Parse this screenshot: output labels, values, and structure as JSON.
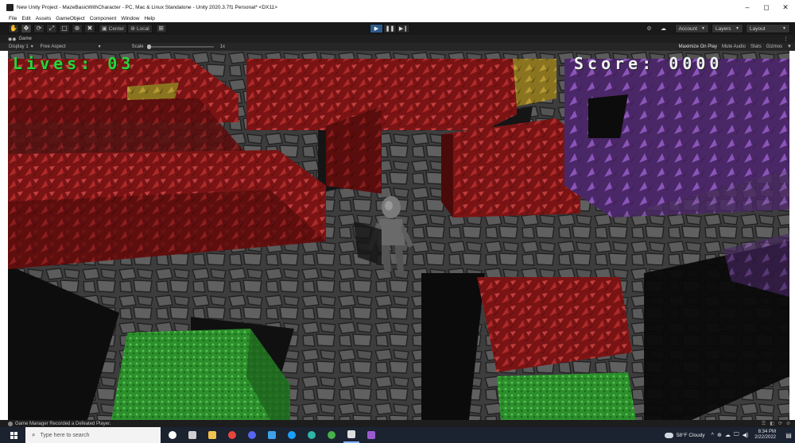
{
  "window": {
    "title": "New Unity Project - MazeBasicWithCharacter - PC, Mac & Linux Standalone - Unity 2020.3.7f1 Personal* <DX11>",
    "controls": [
      "–",
      "◻",
      "✕"
    ]
  },
  "menu": [
    "File",
    "Edit",
    "Assets",
    "GameObject",
    "Component",
    "Window",
    "Help"
  ],
  "toolbar": {
    "tools": [
      "✋",
      "✥",
      "⟳",
      "⤢",
      "▢",
      "⊕",
      "✖"
    ],
    "pivot_label": "Center",
    "space_label": "Local",
    "snap_glyph": "⊞",
    "play": [
      "▶",
      "❚❚",
      "▶❙"
    ],
    "collab_glyph": "⚙",
    "cloud_glyph": "☁",
    "account_label": "Account",
    "layers_label": "Layers",
    "layout_label": "Layout"
  },
  "game_tab": {
    "label": "Game",
    "display": "Display 1",
    "aspect": "Free Aspect",
    "scale_label": "Scale",
    "scale_value": "1x",
    "maximize_on_play": "Maximize On Play",
    "mute_audio": "Mute Audio",
    "stats": "Stats",
    "gizmos": "Gizmos"
  },
  "hud": {
    "lives": "Lives: 03",
    "score": "Score: 0000"
  },
  "status": {
    "message": "Game Manager Recorded a Defeated Player.",
    "right_icons": [
      "☰",
      "◧",
      "⟳",
      "⊘"
    ]
  },
  "taskbar": {
    "search_placeholder": "Type here to search",
    "weather": "58°F Cloudy",
    "tray_glyphs": [
      "^",
      "⊕",
      "☁",
      "🖵",
      "◀)"
    ],
    "time": "8:34 PM",
    "date": "2/22/2022",
    "apps": [
      {
        "name": "cortana",
        "color": "#ffffff",
        "round": true
      },
      {
        "name": "task-view",
        "color": "#d0d0d0",
        "round": false
      },
      {
        "name": "file-explorer",
        "color": "#f2c14e",
        "round": false
      },
      {
        "name": "chrome",
        "color": "#e8463a",
        "round": true
      },
      {
        "name": "discord",
        "color": "#5865f2",
        "round": true
      },
      {
        "name": "vscode-like",
        "color": "#3ea1e8",
        "round": false
      },
      {
        "name": "steam",
        "color": "#1a9fff",
        "round": true
      },
      {
        "name": "edge",
        "color": "#2fb6a7",
        "round": true
      },
      {
        "name": "xbox",
        "color": "#46b04b",
        "round": true
      },
      {
        "name": "unity",
        "color": "#dddddd",
        "round": false
      },
      {
        "name": "visual-studio",
        "color": "#9b59d0",
        "round": false
      }
    ]
  },
  "colors": {
    "lives_text": "#2fd23c",
    "score_text": "#eef2f2",
    "wall_red": "#8e1a1a",
    "wall_purple": "#5a2f78",
    "wall_gold": "#8a7420",
    "wall_green": "#2a8a2a",
    "floor_stone": "#4a4a4a",
    "play_active": "#2d5a8a"
  }
}
